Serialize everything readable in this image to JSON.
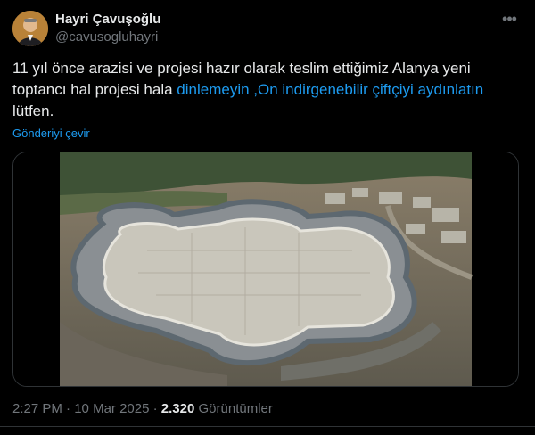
{
  "author": {
    "name": "Hayri Çavuşoğlu",
    "handle": "@cavusogluhayri"
  },
  "more_label": "•••",
  "tweet": {
    "text_plain": "11 yıl önce arazisi ve projesi hazır olarak teslim ettiğimiz Alanya yeni toptancı hal projesi hala ",
    "text_link": "dinlemeyin ,On indirgenebilir çiftçiyi aydınlatın",
    "text_tail": "lütfen.",
    "translate_label": "Gönderiyi çevir"
  },
  "footer": {
    "time": "2:27 PM",
    "separator": "·",
    "date": "10 Mar 2025",
    "views_count": "2.320",
    "views_label": "Görüntümler"
  },
  "colors": {
    "background": "#000000",
    "text": "#e7e9ea",
    "muted": "#71767b",
    "link": "#1d9bf0",
    "border": "#2f3336"
  }
}
